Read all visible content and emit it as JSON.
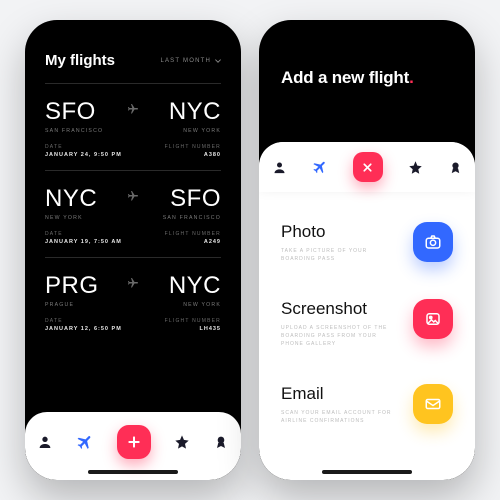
{
  "colors": {
    "accent": "#ff2e56",
    "photo": "#3268ff",
    "screenshot": "#ff2e56",
    "email": "#ffc41f"
  },
  "left": {
    "title": "My flights",
    "filter_label": "LAST MONTH",
    "labels": {
      "date": "DATE",
      "flight_number": "FLIGHT NUMBER"
    },
    "flights": [
      {
        "from_code": "SFO",
        "from_city": "SAN FRANCISCO",
        "to_code": "NYC",
        "to_city": "NEW YORK",
        "date": "JANUARY 24, 9:50 PM",
        "flight_number": "A380"
      },
      {
        "from_code": "NYC",
        "from_city": "NEW YORK",
        "to_code": "SFO",
        "to_city": "SAN FRANCISCO",
        "date": "JANUARY 19, 7:50 AM",
        "flight_number": "A249"
      },
      {
        "from_code": "PRG",
        "from_city": "PRAGUE",
        "to_code": "NYC",
        "to_city": "NEW YORK",
        "date": "JANUARY 12, 6:50 PM",
        "flight_number": "LH435"
      }
    ]
  },
  "right": {
    "title": "Add a new flight",
    "options": [
      {
        "title": "Photo",
        "subtitle": "TAKE A PICTURE OF YOUR BOARDING PASS",
        "icon": "camera-icon",
        "color": "#3268ff"
      },
      {
        "title": "Screenshot",
        "subtitle": "UPLOAD A SCREENSHOT OF THE BOARDING PASS FROM YOUR PHONE GALLERY",
        "icon": "image-icon",
        "color": "#ff2e56"
      },
      {
        "title": "Email",
        "subtitle": "SCAN YOUR EMAIL ACCOUNT FOR AIRLINE CONFIRMATIONS",
        "icon": "mail-icon",
        "color": "#ffc41f"
      }
    ]
  },
  "tabs": [
    {
      "name": "profile-icon"
    },
    {
      "name": "plane-icon"
    },
    {
      "name": "add-icon"
    },
    {
      "name": "star-icon"
    },
    {
      "name": "award-icon"
    }
  ]
}
